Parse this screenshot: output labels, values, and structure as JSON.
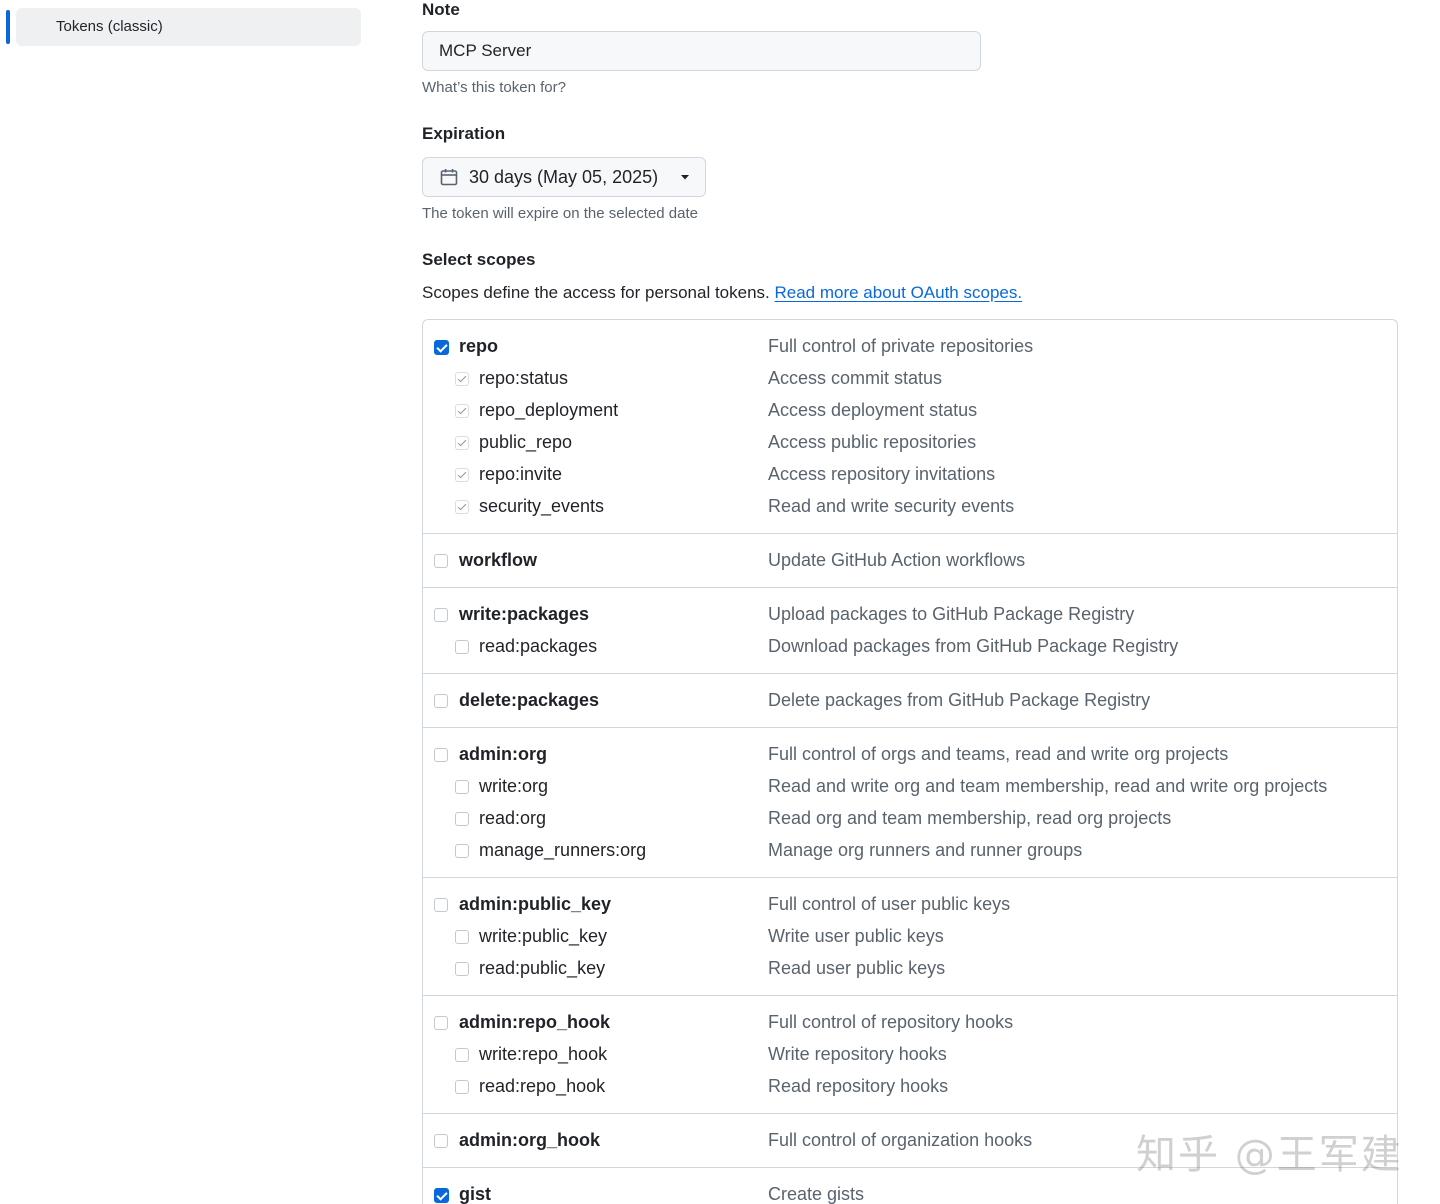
{
  "sidebar": {
    "active_item": "Tokens (classic)"
  },
  "form": {
    "note_label": "Note",
    "note_value": "MCP Server",
    "note_hint": "What’s this token for?",
    "expiration_label": "Expiration",
    "expiration_value": "30 days (May 05, 2025)",
    "expiration_hint": "The token will expire on the selected date",
    "scopes_label": "Select scopes",
    "scopes_desc": "Scopes define the access for personal tokens. ",
    "scopes_link": "Read more about OAuth scopes."
  },
  "scopes": [
    {
      "name": "repo",
      "desc": "Full control of private repositories",
      "checked": true,
      "children": [
        {
          "name": "repo:status",
          "desc": "Access commit status",
          "state": "implied"
        },
        {
          "name": "repo_deployment",
          "desc": "Access deployment status",
          "state": "implied"
        },
        {
          "name": "public_repo",
          "desc": "Access public repositories",
          "state": "implied"
        },
        {
          "name": "repo:invite",
          "desc": "Access repository invitations",
          "state": "implied"
        },
        {
          "name": "security_events",
          "desc": "Read and write security events",
          "state": "implied"
        }
      ]
    },
    {
      "name": "workflow",
      "desc": "Update GitHub Action workflows",
      "checked": false,
      "children": []
    },
    {
      "name": "write:packages",
      "desc": "Upload packages to GitHub Package Registry",
      "checked": false,
      "children": [
        {
          "name": "read:packages",
          "desc": "Download packages from GitHub Package Registry",
          "state": "unchecked"
        }
      ]
    },
    {
      "name": "delete:packages",
      "desc": "Delete packages from GitHub Package Registry",
      "checked": false,
      "children": []
    },
    {
      "name": "admin:org",
      "desc": "Full control of orgs and teams, read and write org projects",
      "checked": false,
      "children": [
        {
          "name": "write:org",
          "desc": "Read and write org and team membership, read and write org projects",
          "state": "unchecked"
        },
        {
          "name": "read:org",
          "desc": "Read org and team membership, read org projects",
          "state": "unchecked"
        },
        {
          "name": "manage_runners:org",
          "desc": "Manage org runners and runner groups",
          "state": "unchecked"
        }
      ]
    },
    {
      "name": "admin:public_key",
      "desc": "Full control of user public keys",
      "checked": false,
      "children": [
        {
          "name": "write:public_key",
          "desc": "Write user public keys",
          "state": "unchecked"
        },
        {
          "name": "read:public_key",
          "desc": "Read user public keys",
          "state": "unchecked"
        }
      ]
    },
    {
      "name": "admin:repo_hook",
      "desc": "Full control of repository hooks",
      "checked": false,
      "children": [
        {
          "name": "write:repo_hook",
          "desc": "Write repository hooks",
          "state": "unchecked"
        },
        {
          "name": "read:repo_hook",
          "desc": "Read repository hooks",
          "state": "unchecked"
        }
      ]
    },
    {
      "name": "admin:org_hook",
      "desc": "Full control of organization hooks",
      "checked": false,
      "children": []
    },
    {
      "name": "gist",
      "desc": "Create gists",
      "checked": true,
      "children": []
    }
  ],
  "watermark": "知乎 @王军建",
  "colors": {
    "accent": "#0969da",
    "border": "#d0d7de",
    "muted_text": "#59636e"
  }
}
